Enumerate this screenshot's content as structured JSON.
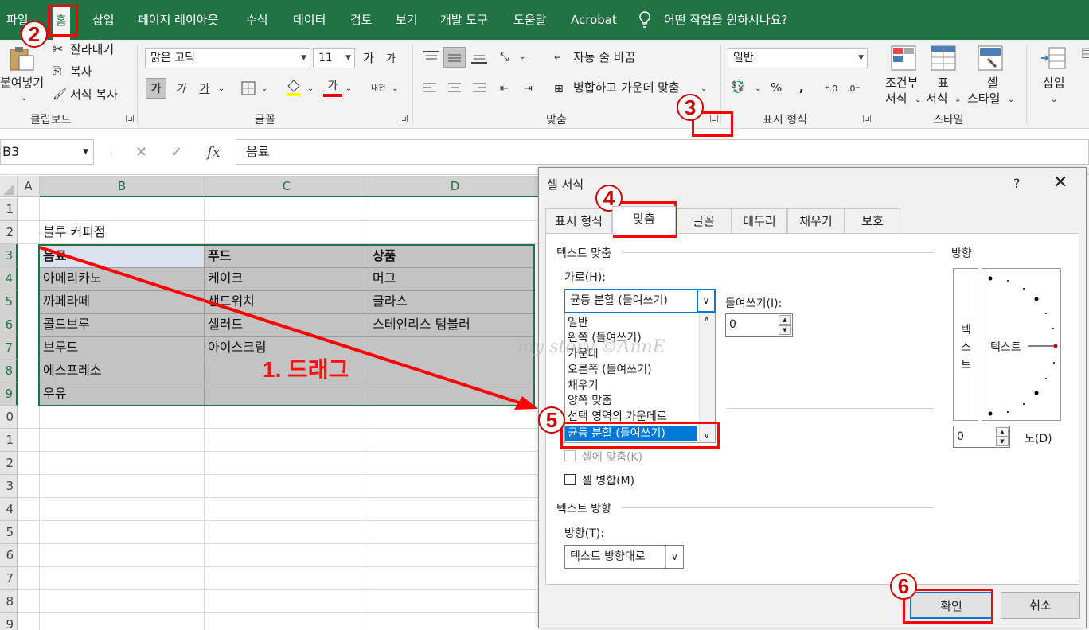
{
  "ribbon_tabs": [
    "파일",
    "홈",
    "삽입",
    "페이지 레이아웃",
    "수식",
    "데이터",
    "검토",
    "보기",
    "개발 도구",
    "도움말",
    "Acrobat"
  ],
  "tell_me": "어떤 작업을 원하시나요?",
  "clipboard": {
    "paste": "붙여넣기",
    "cut": "잘라내기",
    "copy": "복사",
    "format_painter": "서식 복사",
    "label": "클립보드"
  },
  "font": {
    "name": "맑은 고딕",
    "size": "11",
    "bold": "가",
    "italic": "가",
    "underline": "가",
    "font_color": "가",
    "phonetic": "내천",
    "grow": "가",
    "shrink": "가",
    "label": "글꼴"
  },
  "alignment": {
    "wrap": "자동 줄 바꿈",
    "merge": "병합하고 가운데 맞춤",
    "label": "맞춤"
  },
  "number": {
    "format": "일반",
    "percent": "%",
    "comma": ",",
    "label": "표시 형식"
  },
  "styles": {
    "conditional": [
      "조건부",
      "서식"
    ],
    "table": [
      "표",
      "서식"
    ],
    "cell": [
      "셀",
      "스타일"
    ],
    "label": "스타일"
  },
  "cells": {
    "insert": "삽입"
  },
  "formula_bar": {
    "name_box": "B3",
    "fx": "fx",
    "value": "음료"
  },
  "sheet": {
    "col_headers": [
      "A",
      "B",
      "C",
      "D"
    ],
    "row_headers": [
      "1",
      "2",
      "3",
      "4",
      "5",
      "6",
      "7",
      "8",
      "9",
      "0",
      "1",
      "2",
      "3",
      "4",
      "5",
      "6",
      "7",
      "8",
      "9"
    ],
    "title": "블루 커피점",
    "table_header": [
      "음료",
      "푸드",
      "상품"
    ],
    "rows": [
      [
        "아메리카노",
        "케이크",
        "머그"
      ],
      [
        "까페라떼",
        "샌드위치",
        "글라스"
      ],
      [
        "콜드브루",
        "샐러드",
        "스테인리스 텀블러"
      ],
      [
        "브루드",
        "아이스크림",
        ""
      ],
      [
        "에스프레소",
        "",
        ""
      ],
      [
        "우유",
        "",
        ""
      ]
    ]
  },
  "dialog": {
    "title": "셀 서식",
    "help": "?",
    "tabs": [
      "표시 형식",
      "맞춤",
      "글꼴",
      "테두리",
      "채우기",
      "보호"
    ],
    "text_align_section": "텍스트 맞춤",
    "horizontal_label": "가로(H):",
    "horizontal_value": "균등 분할 (들여쓰기)",
    "horizontal_options": [
      "일반",
      "왼쪽 (들여쓰기)",
      "가운데",
      "오른쪽 (들여쓰기)",
      "채우기",
      "양쪽 맞춤",
      "선택 영역의 가운데로",
      "균등 분할 (들여쓰기)"
    ],
    "indent_label": "들여쓰기(I):",
    "indent_value": "0",
    "shrink_label": "셀에 맞춤(K)",
    "merge_label": "셀 병합(M)",
    "text_dir_section": "텍스트 방향",
    "direction_label": "방향(T):",
    "direction_value": "텍스트 방향대로",
    "orientation_section": "방향",
    "orientation_vertical": [
      "텍",
      "스",
      "트"
    ],
    "orientation_text": "텍스트",
    "degrees_value": "0",
    "degrees_label": "도(D)",
    "ok": "확인",
    "cancel": "취소"
  },
  "annotations": {
    "drag": "1. 드래그",
    "steps": [
      "2",
      "3",
      "4",
      "5",
      "6"
    ],
    "watermark": "my story ©AnnE",
    "color": "#ff0000"
  },
  "colors": {
    "excel_green": "#217346",
    "selection_gray": "#c3c3c3",
    "accent_blue": "#0078d7"
  }
}
